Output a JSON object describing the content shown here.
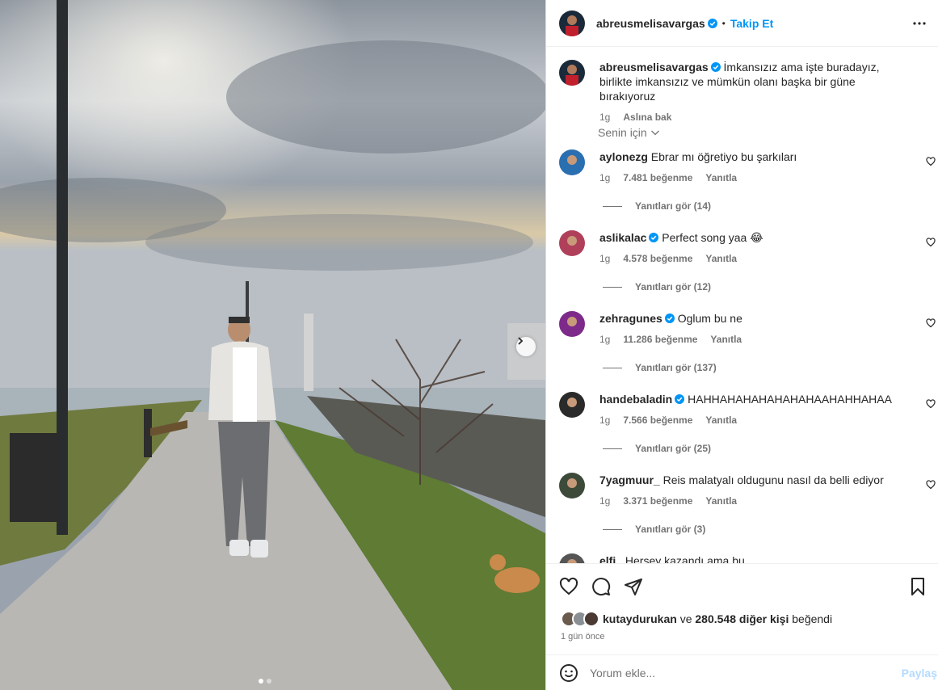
{
  "post": {
    "author": "abreusmelisavargas",
    "follow_label": "Takip Et",
    "dot": "•",
    "caption": "İmkansızız ama işte buradayız, birlikte imkansızız ve mümkün olanı başka bir güne bırakıyoruz",
    "caption_age": "1g",
    "translate_label": "Aslına bak",
    "sort_label": "Senin için"
  },
  "comments": [
    {
      "user": "aylonezg",
      "verified": false,
      "text": "Ebrar mı öğretiyo bu şarkıları",
      "age": "1g",
      "likes": "7.481 beğenme",
      "reply": "Yanıtla",
      "replies": "Yanıtları gör (14)"
    },
    {
      "user": "aslikalac",
      "verified": true,
      "text": "Perfect song yaa 😂",
      "age": "1g",
      "likes": "4.578 beğenme",
      "reply": "Yanıtla",
      "replies": "Yanıtları gör (12)"
    },
    {
      "user": "zehragunes",
      "verified": true,
      "text": "Oglum bu ne",
      "age": "1g",
      "likes": "11.286 beğenme",
      "reply": "Yanıtla",
      "replies": "Yanıtları gör (137)"
    },
    {
      "user": "handebaladin",
      "verified": true,
      "text": "HAHHAHAHAHAHAHAHAAHAHHAHAA",
      "age": "1g",
      "likes": "7.566 beğenme",
      "reply": "Yanıtla",
      "replies": "Yanıtları gör (25)"
    },
    {
      "user": "7yagmuur_",
      "verified": false,
      "text": "Reis malatyalı oldugunu nasıl da belli ediyor",
      "age": "1g",
      "likes": "3.371 beğenme",
      "reply": "Yanıtla",
      "replies": "Yanıtları gör (3)"
    },
    {
      "user": "elfi_",
      "verified": false,
      "text": "Herşey kazandı ama bu DKAKDKWKDAKDIAKWJDKD",
      "age": "",
      "likes": "",
      "reply": "",
      "replies": ""
    }
  ],
  "footer": {
    "liked_by_user": "kutaydurukan",
    "liked_by_conj": "ve",
    "liked_by_others": "280.548 diğer kişi",
    "liked_suffix": "beğendi",
    "time": "1 gün önce",
    "comment_placeholder": "Yorum ekle...",
    "post_label": "Paylaş"
  },
  "colors": {
    "accent": "#0095f6",
    "verified": "#0095f6",
    "muted": "#737373"
  },
  "icons": [
    "more-icon",
    "heart-icon",
    "comment-icon",
    "share-icon",
    "bookmark-icon",
    "emoji-icon",
    "chevron-right-icon",
    "chevron-down-icon",
    "verified-icon"
  ]
}
